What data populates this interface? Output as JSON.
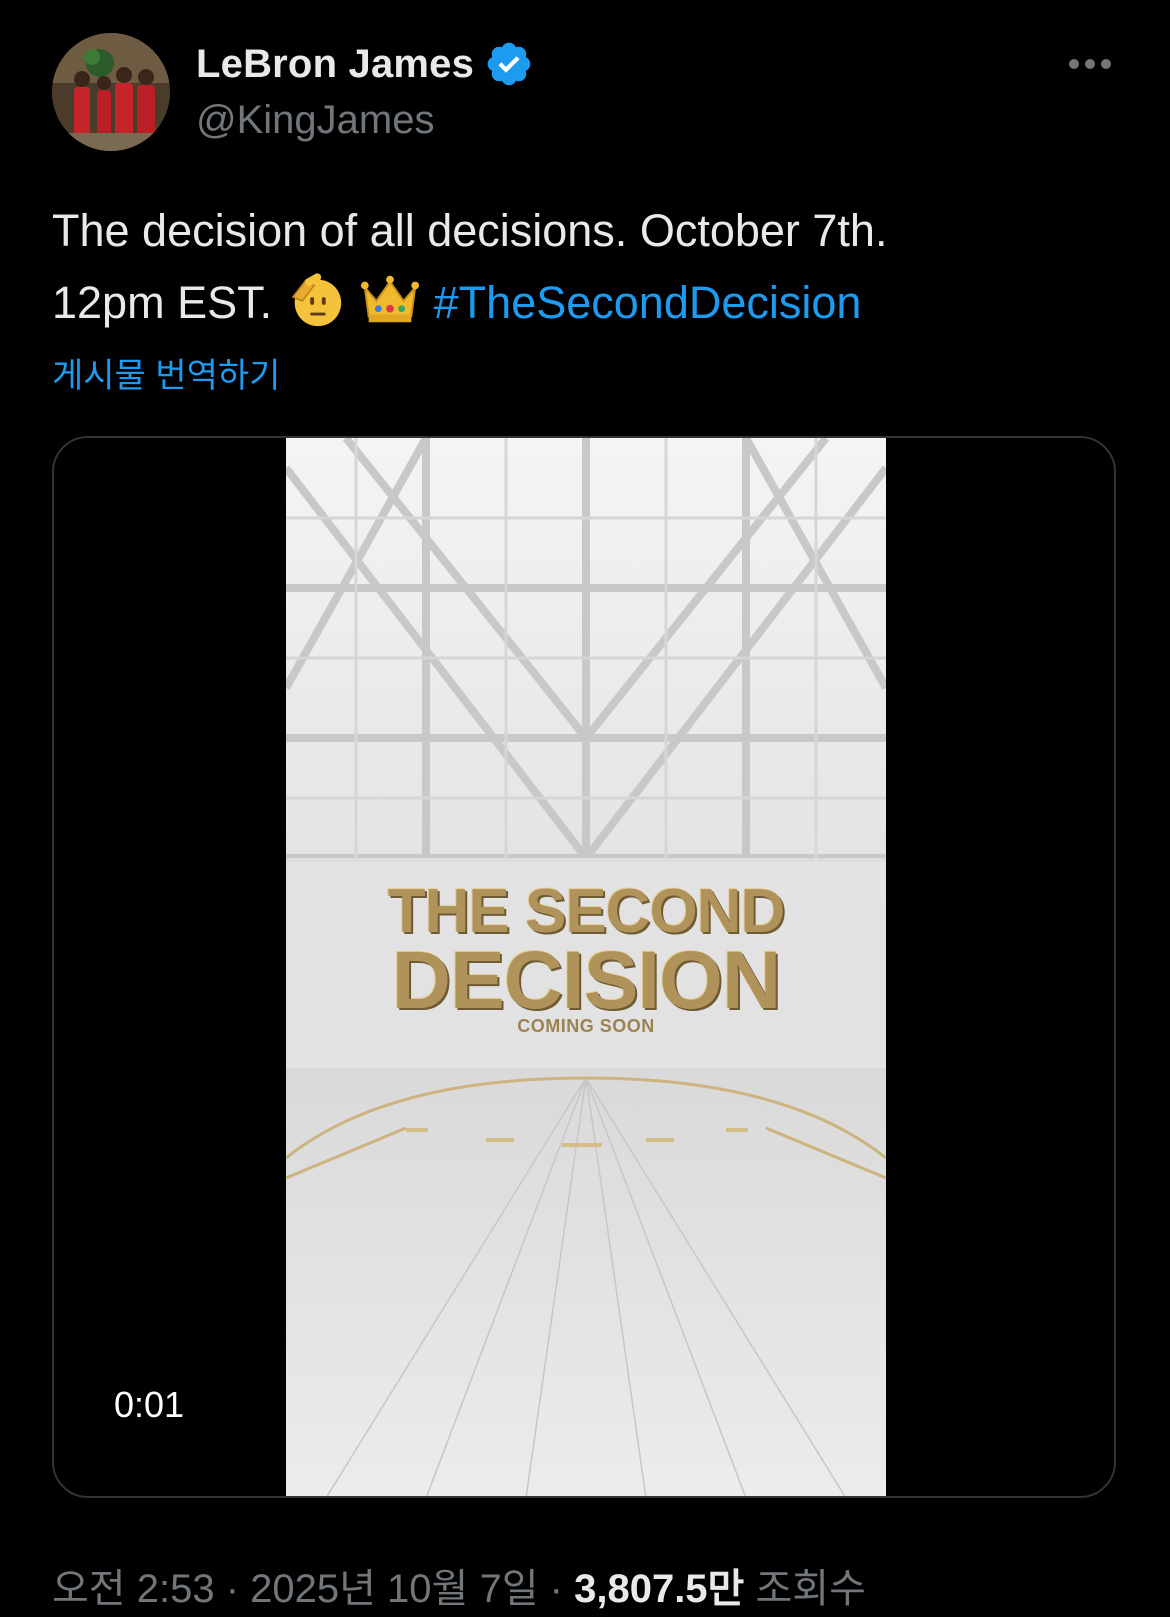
{
  "author": {
    "display_name": "LeBron James",
    "handle": "@KingJames",
    "verified": true,
    "verified_color": "#1d9bf0"
  },
  "tweet": {
    "text_line_1": "The decision of all decisions. October 7th.",
    "text_line_2": "12pm EST.",
    "emojis": [
      "saluting-face-icon",
      "crown-icon"
    ],
    "hashtag": "#TheSecondDecision",
    "translate_label": "게시물 번역하기"
  },
  "media": {
    "title_line_1": "THE SECOND",
    "title_line_2": "DECISION",
    "subtitle": "COMING SOON",
    "elapsed_time": "0:01"
  },
  "meta": {
    "time": "오전 2:53",
    "separator": "·",
    "date": "2025년 10월 7일",
    "views_count": "3,807.5만",
    "views_label": "조회수"
  },
  "colors": {
    "background": "#000000",
    "text_primary": "#e7e9ea",
    "text_secondary": "#71767b",
    "link": "#1d9bf0",
    "card_border": "#2f3336",
    "gold": "#b0925b"
  }
}
